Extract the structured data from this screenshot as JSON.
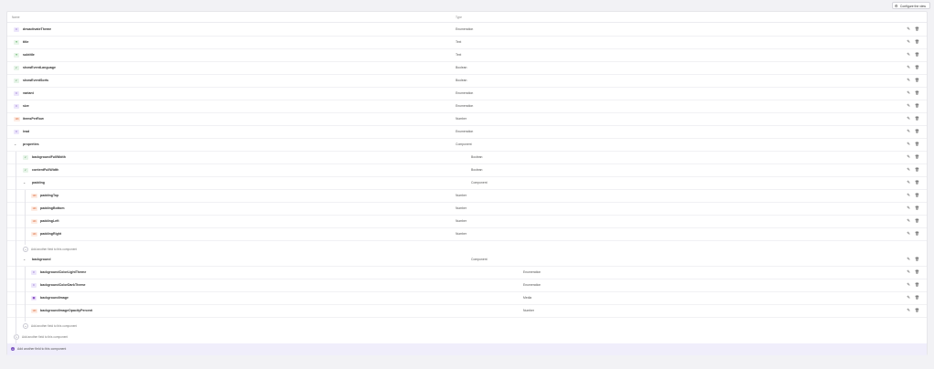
{
  "toolbar": {
    "configure_label": "Configure the view"
  },
  "table": {
    "col_name": "Name",
    "col_type": "Type"
  },
  "rows": [
    {
      "name": "desactivateTheme",
      "type": "Enumeration",
      "badge": "enum"
    },
    {
      "name": "title",
      "type": "Text",
      "badge": "text"
    },
    {
      "name": "subtitle",
      "type": "Text",
      "badge": "text"
    },
    {
      "name": "showEventLanguage",
      "type": "Boolean",
      "badge": "bool"
    },
    {
      "name": "showEventSorts",
      "type": "Boolean",
      "badge": "bool"
    },
    {
      "name": "variant",
      "type": "Enumeration",
      "badge": "enum"
    },
    {
      "name": "size",
      "type": "Enumeration",
      "badge": "enum"
    },
    {
      "name": "itemsPerRow",
      "type": "Number",
      "badge": "num"
    },
    {
      "name": "lead",
      "type": "Enumeration",
      "badge": "enum"
    },
    {
      "name": "properties",
      "type": "Component",
      "badge": "component"
    },
    {
      "name": "backgroundFullWidth",
      "type": "Boolean",
      "badge": "bool"
    },
    {
      "name": "contentFullWidth",
      "type": "Boolean",
      "badge": "bool"
    },
    {
      "name": "padding",
      "type": "Component",
      "badge": "component"
    },
    {
      "name": "paddingTop",
      "type": "Number",
      "badge": "num"
    },
    {
      "name": "paddingBottom",
      "type": "Number",
      "badge": "num"
    },
    {
      "name": "paddingLeft",
      "type": "Number",
      "badge": "num"
    },
    {
      "name": "paddingRight",
      "type": "Number",
      "badge": "num"
    },
    {
      "name": "background",
      "type": "Component",
      "badge": "component"
    },
    {
      "name": "backgroundColorLightTheme",
      "type": "Enumeration",
      "badge": "enum"
    },
    {
      "name": "backgroundColorDarkTheme",
      "type": "Enumeration",
      "badge": "enum"
    },
    {
      "name": "backgroundImage",
      "type": "Media",
      "badge": "img"
    },
    {
      "name": "backgroundImageOpacityPercent",
      "type": "Number",
      "badge": "num"
    }
  ],
  "add_field_in_component": "Add another field to this component",
  "add_field_in_component_2": "Add another field to this component",
  "add_field_in_component_3": "Add another field to this component",
  "footer_add": "Add another field to this component",
  "icons": {
    "edit": "pencil-icon",
    "delete": "trash-icon",
    "toggle": "chevron-down-icon",
    "settings": "settings-icon"
  }
}
